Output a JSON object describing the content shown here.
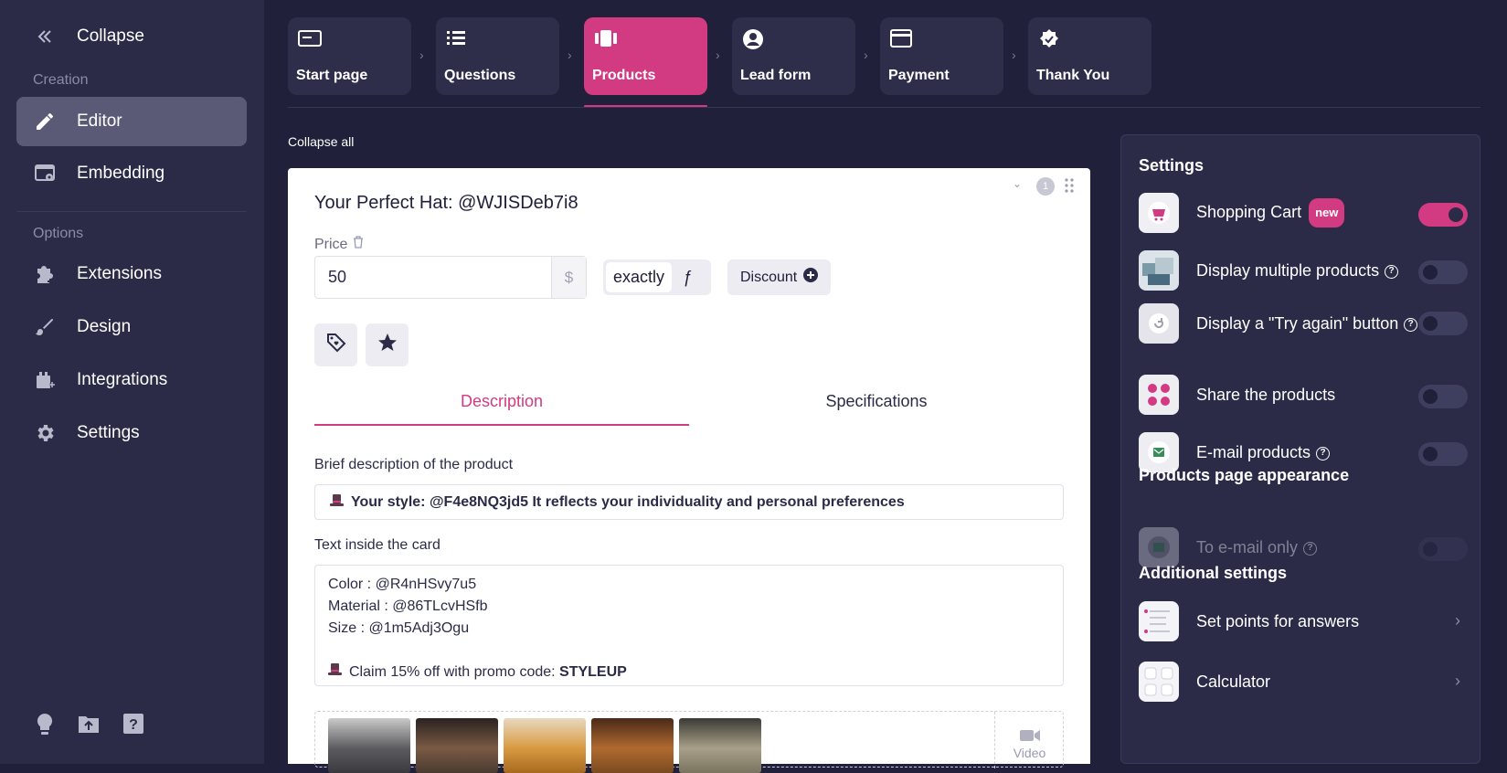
{
  "sidebar": {
    "collapse_label": "Collapse",
    "section_creation": "Creation",
    "section_options": "Options",
    "items": [
      {
        "label": "Editor",
        "icon": "pencil-icon",
        "active": true
      },
      {
        "label": "Embedding",
        "icon": "embed-icon",
        "active": false
      },
      {
        "label": "Extensions",
        "icon": "puzzle-icon",
        "active": false
      },
      {
        "label": "Design",
        "icon": "brush-icon",
        "active": false
      },
      {
        "label": "Integrations",
        "icon": "plugin-icon",
        "active": false
      },
      {
        "label": "Settings",
        "icon": "gear-icon",
        "active": false
      }
    ],
    "bottom_icons": [
      "lightbulb-icon",
      "folder-upload-icon",
      "help-icon"
    ]
  },
  "steps": [
    {
      "label": "Start page",
      "icon": "start-page-icon"
    },
    {
      "label": "Questions",
      "icon": "list-icon"
    },
    {
      "label": "Products",
      "icon": "products-icon",
      "active": true
    },
    {
      "label": "Lead form",
      "icon": "user-circle-icon"
    },
    {
      "label": "Payment",
      "icon": "card-icon"
    },
    {
      "label": "Thank You",
      "icon": "verified-icon"
    }
  ],
  "collapse_all": "Collapse all",
  "product": {
    "title": "Your Perfect Hat: @WJISDeb7i8",
    "index": "1",
    "price_label": "Price",
    "price_value": "50",
    "currency": "$",
    "price_mode": "exactly",
    "formula_symbol": "ƒ",
    "discount_label": "Discount",
    "tabs": [
      "Description",
      "Specifications"
    ],
    "brief_label": "Brief description of the product",
    "brief_text": "Your style: @F4e8NQ3jd5 It reflects your individuality and personal preferences",
    "card_text_label": "Text inside the card",
    "card_lines": [
      "Color : @R4nHSvy7u5",
      "Material : @86TLcvHSfb",
      "Size : @1m5Adj3Ogu"
    ],
    "promo_prefix": "Claim 15% off with promo code: ",
    "promo_code": "STYLEUP",
    "video_label": "Video"
  },
  "settings": {
    "title": "Settings",
    "rows": [
      {
        "label": "Shopping Cart",
        "badge": "new",
        "on": true
      },
      {
        "label": "Display multiple products",
        "help": true,
        "on": false
      },
      {
        "label": "Display a \"Try again\" button",
        "help": true,
        "on": false
      },
      {
        "label": "Share the products",
        "on": false
      },
      {
        "label": "E-mail products",
        "help": true,
        "on": false
      }
    ],
    "appearance_title": "Products page appearance",
    "appearance_row": {
      "label": "To e-mail only",
      "help": true,
      "on": false,
      "disabled": true
    },
    "additional_title": "Additional settings",
    "additional_rows": [
      {
        "label": "Set points for answers"
      },
      {
        "label": "Calculator"
      }
    ]
  },
  "colors": {
    "accent": "#d23a82",
    "bg": "#20203a",
    "sidebar": "#2b2b48"
  }
}
